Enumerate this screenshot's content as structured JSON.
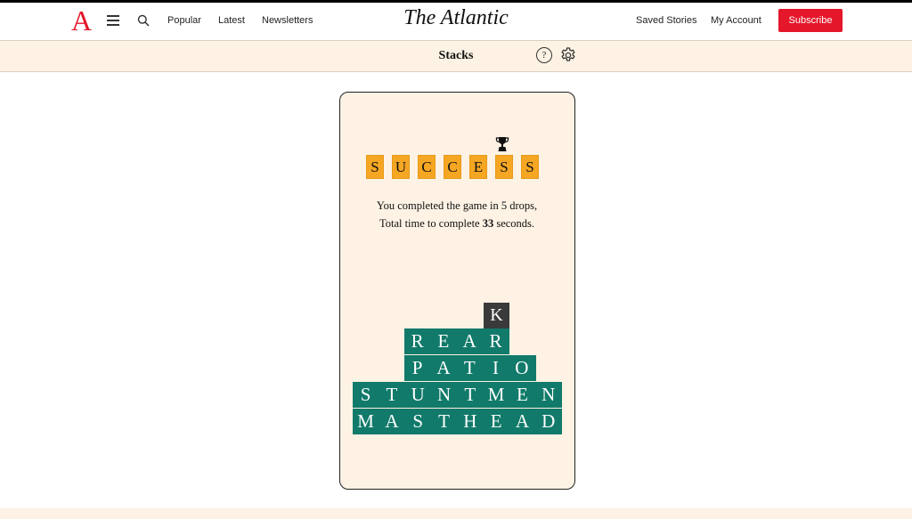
{
  "header": {
    "logo": "A",
    "nav_links": [
      "Popular",
      "Latest",
      "Newsletters"
    ],
    "brand": "The Atlantic",
    "saved_stories": "Saved Stories",
    "my_account": "My Account",
    "subscribe": "Subscribe"
  },
  "subheader": {
    "title": "Stacks",
    "help_icon": "?"
  },
  "game": {
    "success_letters": [
      "S",
      "U",
      "C",
      "C",
      "E",
      "S",
      "S"
    ],
    "message_line1": "You completed the game in 5 drops,",
    "message_line2_prefix": "Total time to complete",
    "seconds": "33",
    "message_line2_suffix": "seconds.",
    "falling_tile": "K",
    "stack_words": [
      "REAR",
      "PATIO",
      "STUNTMEN",
      "MASTHEAD"
    ]
  },
  "colors": {
    "accent_red": "#e4172b",
    "tile_orange": "#f5a623",
    "word_green": "#117a6a",
    "cream": "#fdf2e4"
  }
}
